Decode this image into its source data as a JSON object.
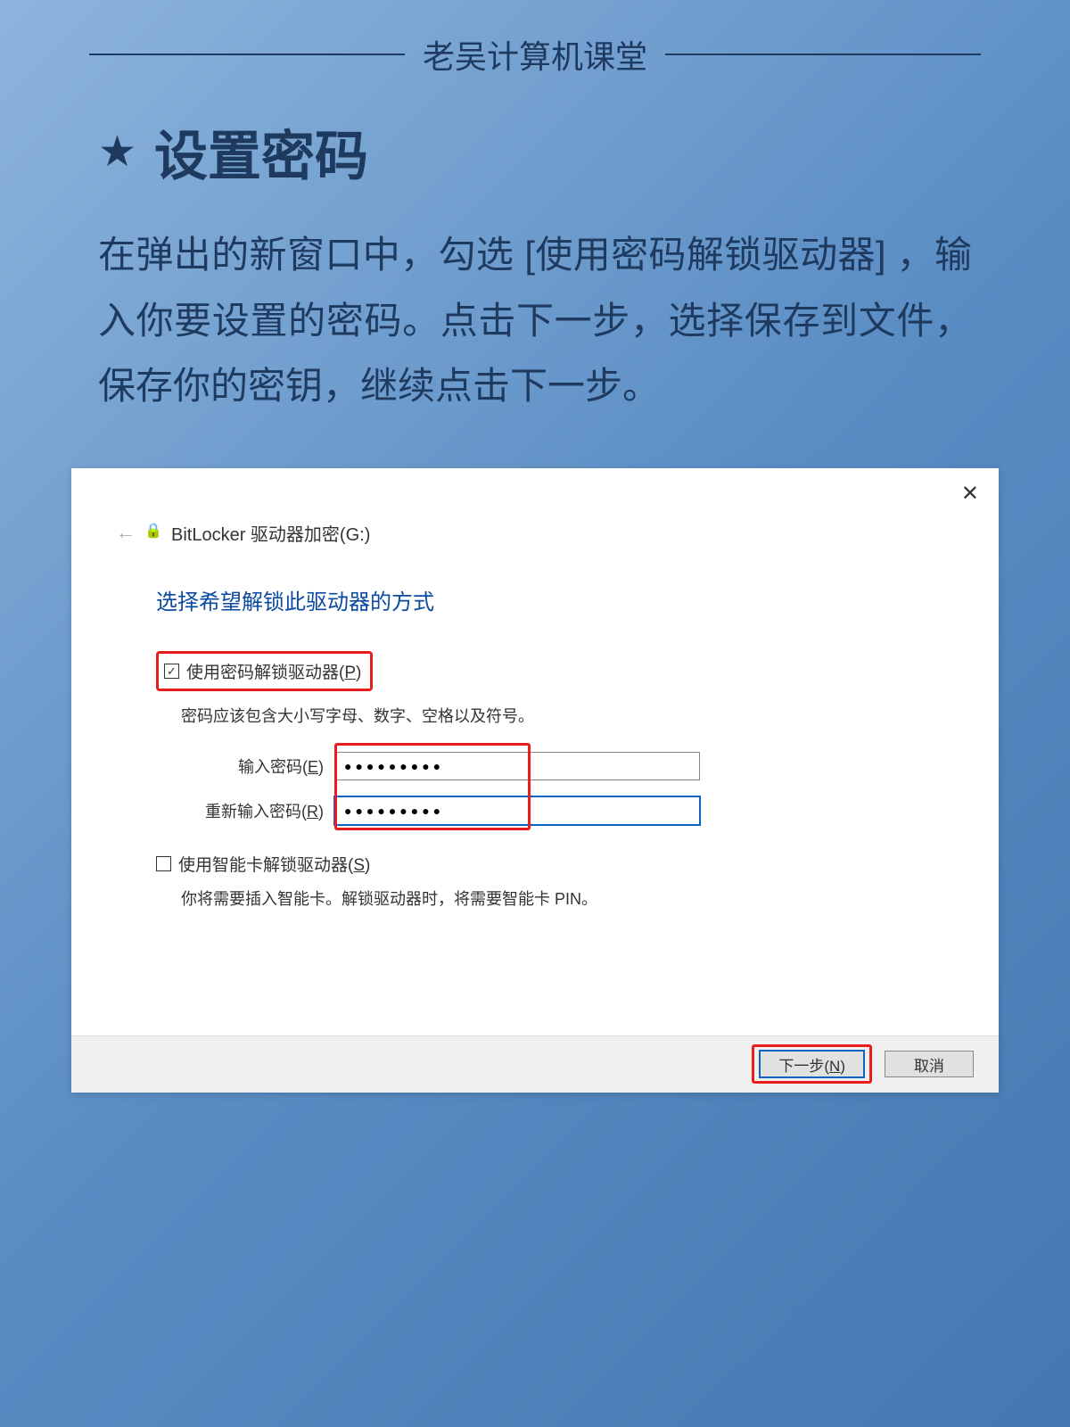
{
  "header": {
    "title": "老吴计算机课堂"
  },
  "section": {
    "star": "★",
    "title": "设置密码",
    "description": "在弹出的新窗口中，勾选 [使用密码解锁驱动器] ，输入你要设置的密码。点击下一步，选择保存到文件，保存你的密钥，继续点击下一步。"
  },
  "win": {
    "close": "✕",
    "back": "←",
    "title": "BitLocker 驱动器加密(G:)",
    "prompt": "选择希望解锁此驱动器的方式",
    "opt1_label": "使用密码解锁驱动器(P)",
    "opt1_desc": "密码应该包含大小写字母、数字、空格以及符号。",
    "pw1_label": "输入密码(E)",
    "pw2_label": "重新输入密码(R)",
    "pw_mask": "●●●●●●●●●",
    "opt2_label": "使用智能卡解锁驱动器(S)",
    "opt2_desc": "你将需要插入智能卡。解锁驱动器时，将需要智能卡 PIN。",
    "next_btn": "下一步(N)",
    "cancel_btn": "取消"
  }
}
